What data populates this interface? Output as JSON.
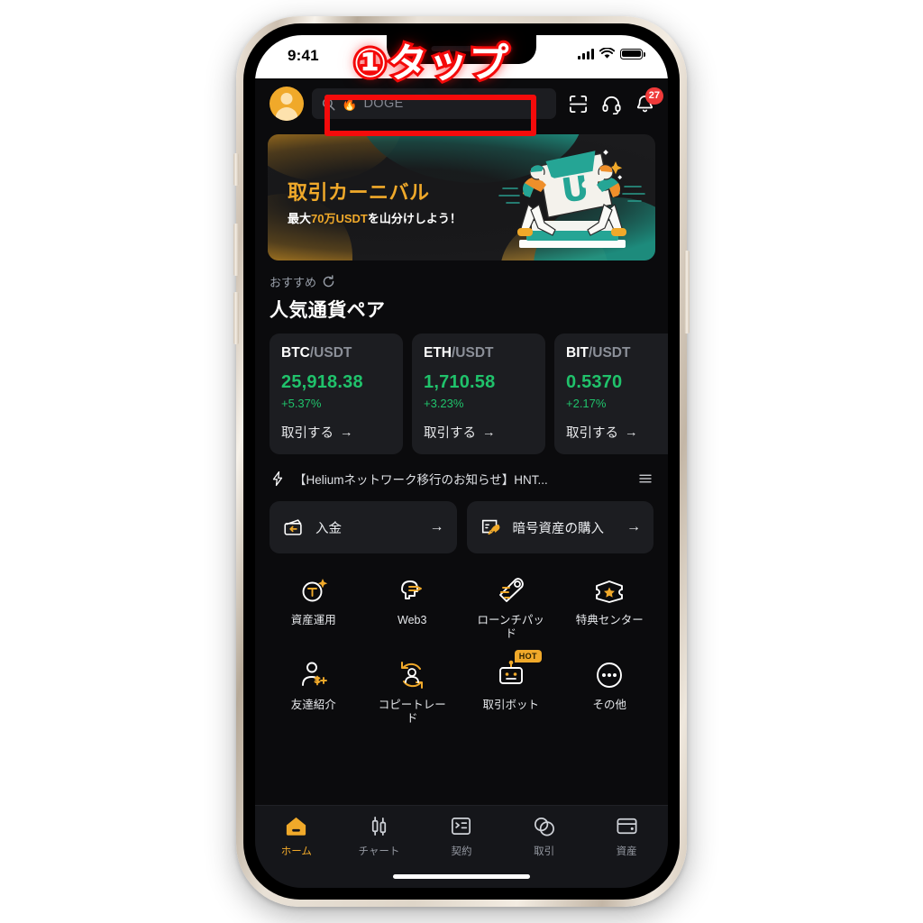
{
  "annotation": {
    "step_label": "①タップ",
    "highlight_color": "#f50b0b"
  },
  "status_bar": {
    "time": "9:41",
    "signal_icon": "signal-bars-icon",
    "wifi_icon": "wifi-icon",
    "battery_icon": "battery-icon"
  },
  "header": {
    "avatar_icon": "avatar-icon",
    "search": {
      "placeholder": "DOGE",
      "search_icon": "search-icon",
      "trending_icon": "🔥"
    },
    "scan_icon": "scan-icon",
    "support_icon": "headset-icon",
    "notification_icon": "bell-icon",
    "notification_count": "27"
  },
  "banner": {
    "title": "取引カーニバル",
    "subtitle_prefix": "最大",
    "subtitle_highlight": "70万USDT",
    "subtitle_suffix": "を山分けしよう！",
    "art_icon": "wallet-carry-illustration",
    "accent_color": "#f0a92a",
    "teal_color": "#1e9182"
  },
  "section": {
    "recommend_label": "おすすめ",
    "refresh_icon": "refresh-icon",
    "title": "人気通貨ペア"
  },
  "pairs": [
    {
      "base": "BTC",
      "quote": "/USDT",
      "price": "25,918.38",
      "change": "+5.37%",
      "cta": "取引する"
    },
    {
      "base": "ETH",
      "quote": "/USDT",
      "price": "1,710.58",
      "change": "+3.23%",
      "cta": "取引する"
    },
    {
      "base": "BIT",
      "quote": "/USDT",
      "price": "0.5370",
      "change": "+2.17%",
      "cta": "取引する"
    }
  ],
  "news": {
    "bolt_icon": "lightning-icon",
    "text": "【Heliumネットワーク移行のお知らせ】HNT...",
    "menu_icon": "list-icon"
  },
  "actions": [
    {
      "label": "入金",
      "icon": "wallet-deposit-icon",
      "arrow": "→"
    },
    {
      "label": "暗号資産の購入",
      "icon": "buy-crypto-rocket-icon",
      "arrow": "→"
    }
  ],
  "grid": [
    {
      "label": "資産運用",
      "icon": "earn-coin-icon",
      "badge": ""
    },
    {
      "label": "Web3",
      "icon": "web3-head-icon",
      "badge": ""
    },
    {
      "label": "ローンチパッド",
      "icon": "launchpad-icon",
      "badge": ""
    },
    {
      "label": "特典センター",
      "icon": "rewards-ticket-icon",
      "badge": ""
    },
    {
      "label": "友達紹介",
      "icon": "referral-person-icon",
      "badge": ""
    },
    {
      "label": "コピートレード",
      "icon": "copy-trade-icon",
      "badge": ""
    },
    {
      "label": "取引ボット",
      "icon": "trading-bot-icon",
      "badge": "HOT"
    },
    {
      "label": "その他",
      "icon": "more-dots-icon",
      "badge": ""
    }
  ],
  "tabbar": [
    {
      "label": "ホーム",
      "icon": "home-icon",
      "active": true
    },
    {
      "label": "チャート",
      "icon": "candlestick-icon",
      "active": false
    },
    {
      "label": "契約",
      "icon": "contract-icon",
      "active": false
    },
    {
      "label": "取引",
      "icon": "trade-icon",
      "active": false
    },
    {
      "label": "資産",
      "icon": "assets-wallet-icon",
      "active": false
    }
  ],
  "colors": {
    "accent": "#f0a92a",
    "up": "#20c26b",
    "bg": "#0b0b0d",
    "card": "#1c1d21",
    "badge_red": "#ef3a3a"
  }
}
